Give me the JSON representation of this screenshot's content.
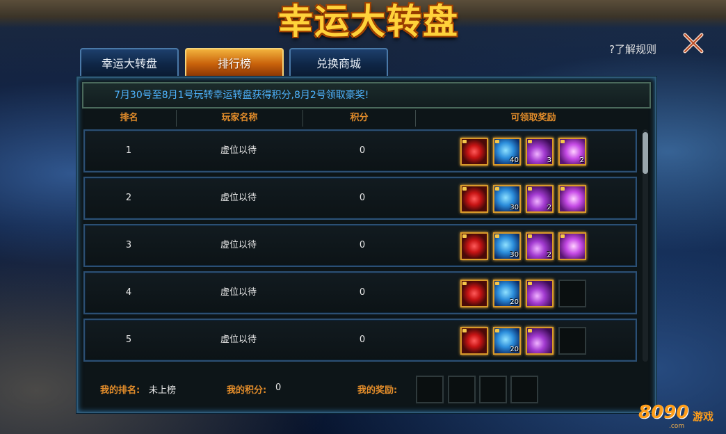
{
  "title": "幸运大转盘",
  "help_label": "?了解规则",
  "tabs": [
    {
      "label": "幸运大转盘",
      "active": false
    },
    {
      "label": "排行榜",
      "active": true
    },
    {
      "label": "兑换商城",
      "active": false
    }
  ],
  "notice": "7月30号至8月1号玩转幸运转盘获得积分,8月2号领取豪奖!",
  "table": {
    "headers": [
      "排名",
      "玩家名称",
      "积分",
      "可领取奖励"
    ],
    "rows": [
      {
        "rank": "1",
        "name": "虚位以待",
        "score": "0",
        "rewards": [
          {
            "icon": "red-gem-icon",
            "count": ""
          },
          {
            "icon": "blue-dragon-icon",
            "count": "40"
          },
          {
            "icon": "purple-orb-icon",
            "count": "3"
          },
          {
            "icon": "purple-crystal-icon",
            "count": "2"
          }
        ]
      },
      {
        "rank": "2",
        "name": "虚位以待",
        "score": "0",
        "rewards": [
          {
            "icon": "red-gem-icon",
            "count": ""
          },
          {
            "icon": "blue-dragon-icon",
            "count": "30"
          },
          {
            "icon": "purple-orb-icon",
            "count": "2"
          },
          {
            "icon": "purple-crystal-icon",
            "count": ""
          }
        ]
      },
      {
        "rank": "3",
        "name": "虚位以待",
        "score": "0",
        "rewards": [
          {
            "icon": "red-gem-icon",
            "count": ""
          },
          {
            "icon": "blue-dragon-icon",
            "count": "30"
          },
          {
            "icon": "purple-orb-icon",
            "count": "2"
          },
          {
            "icon": "purple-crystal-icon",
            "count": ""
          }
        ]
      },
      {
        "rank": "4",
        "name": "虚位以待",
        "score": "0",
        "rewards": [
          {
            "icon": "red-gem-icon",
            "count": ""
          },
          {
            "icon": "blue-dragon-icon",
            "count": "20"
          },
          {
            "icon": "purple-orb-icon",
            "count": ""
          },
          {
            "icon": "empty-slot",
            "count": ""
          }
        ]
      },
      {
        "rank": "5",
        "name": "虚位以待",
        "score": "0",
        "rewards": [
          {
            "icon": "red-gem-icon",
            "count": ""
          },
          {
            "icon": "blue-dragon-icon",
            "count": "20"
          },
          {
            "icon": "purple-orb-icon",
            "count": ""
          },
          {
            "icon": "empty-slot",
            "count": ""
          }
        ]
      }
    ]
  },
  "footer": {
    "my_rank_label": "我的排名:",
    "my_rank_value": "未上榜",
    "my_score_label": "我的积分:",
    "my_score_value": "0",
    "my_reward_label": "我的奖励:"
  },
  "logo": {
    "brand": "8090",
    "cn": "游戏",
    "suffix": ".com"
  },
  "colors": {
    "accent": "#e28c2a",
    "notice": "#4fb4ff",
    "tab_active": "#e08a1e",
    "tab_inactive": "#17345c"
  }
}
